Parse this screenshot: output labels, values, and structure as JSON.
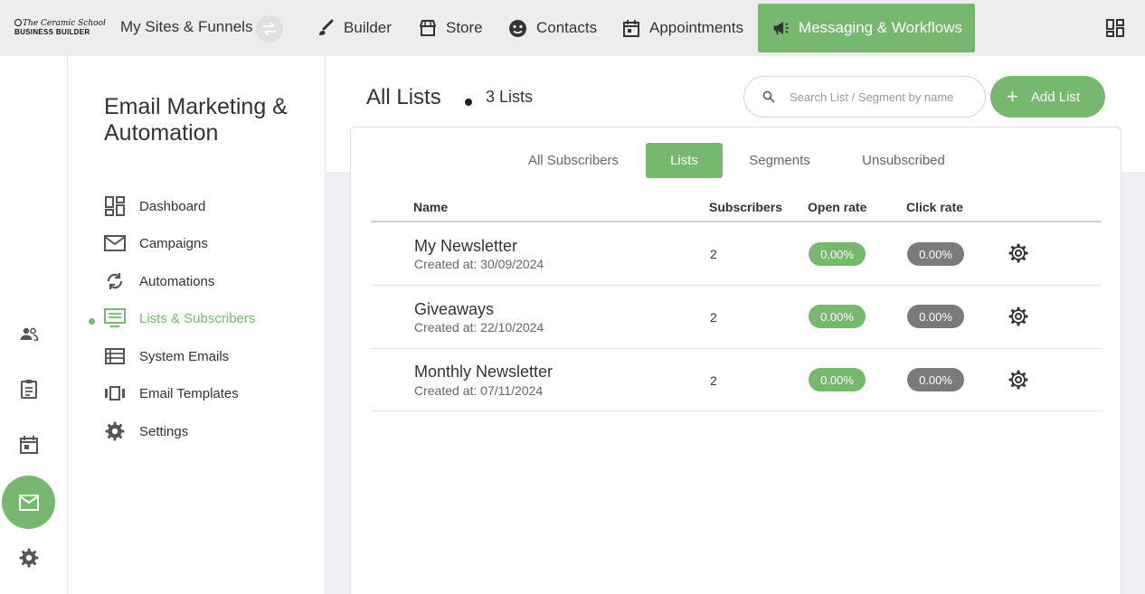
{
  "topbar": {
    "logo_line1": "The Ceramic School",
    "logo_line2": "BUSINESS BUILDER",
    "sites_label": "My Sites & Funnels",
    "nav": [
      {
        "label": "Builder",
        "icon": "brush-icon"
      },
      {
        "label": "Store",
        "icon": "store-icon"
      },
      {
        "label": "Contacts",
        "icon": "contacts-icon"
      },
      {
        "label": "Appointments",
        "icon": "calendar-icon"
      },
      {
        "label": "Messaging & Workflows",
        "icon": "megaphone-icon",
        "active": true
      }
    ],
    "apps_icon": "dashboard-grid-icon"
  },
  "rail": {
    "icons": [
      "people-icon",
      "clipboard-icon",
      "calendar-icon",
      "mail-icon",
      "gear-icon"
    ],
    "active": "mail-icon"
  },
  "sidebar": {
    "title": "Email Marketing & Automation",
    "items": [
      {
        "label": "Dashboard",
        "icon": "dashboard-icon"
      },
      {
        "label": "Campaigns",
        "icon": "envelope-icon"
      },
      {
        "label": "Automations",
        "icon": "sync-icon"
      },
      {
        "label": "Lists & Subscribers",
        "icon": "subscribers-icon",
        "active": true
      },
      {
        "label": "System Emails",
        "icon": "list-icon"
      },
      {
        "label": "Email Templates",
        "icon": "carousel-icon"
      },
      {
        "label": "Settings",
        "icon": "gear-icon"
      }
    ]
  },
  "main": {
    "title": "All Lists",
    "count": "3 Lists",
    "search_placeholder": "Search List / Segment by name",
    "add_label": "Add List",
    "tabs": [
      {
        "label": "All Subscribers"
      },
      {
        "label": "Lists",
        "active": true
      },
      {
        "label": "Segments"
      },
      {
        "label": "Unsubscribed"
      }
    ],
    "columns": [
      "Name",
      "Subscribers",
      "Open rate",
      "Click rate"
    ],
    "rows": [
      {
        "name": "My Newsletter",
        "created": "Created at: 30/09/2024",
        "subscribers": "2",
        "open_rate": "0.00%",
        "click_rate": "0.00%"
      },
      {
        "name": "Giveaways",
        "created": "Created at: 22/10/2024",
        "subscribers": "2",
        "open_rate": "0.00%",
        "click_rate": "0.00%"
      },
      {
        "name": "Monthly Newsletter",
        "created": "Created at: 07/11/2024",
        "subscribers": "2",
        "open_rate": "0.00%",
        "click_rate": "0.00%"
      }
    ]
  },
  "colors": {
    "accent": "#76b86e",
    "grey_pill": "#7a7a7a",
    "topbar": "#ededed",
    "content_bg": "#eef0f5"
  }
}
